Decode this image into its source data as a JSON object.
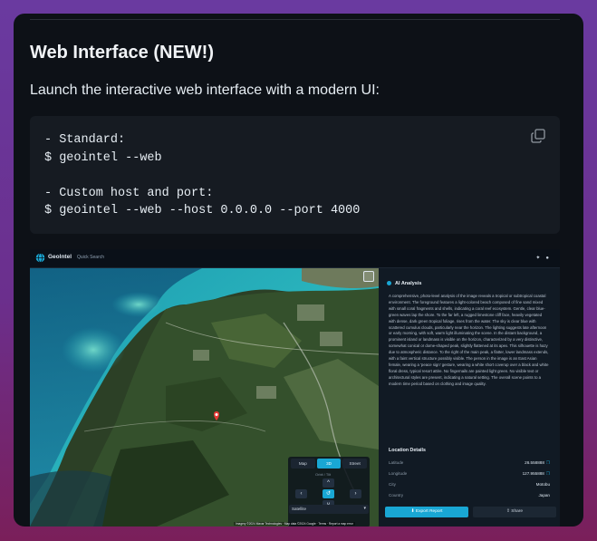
{
  "heading": "Web Interface (NEW!)",
  "lead": "Launch the interactive web interface with a modern UI:",
  "code": {
    "lines": [
      "- Standard:",
      "$ geointel --web",
      "",
      "- Custom host and port:",
      "$ geointel --web --host 0.0.0.0 --port 4000"
    ],
    "copy_icon": "copy-icon"
  },
  "app": {
    "brand": "GeoIntel",
    "nav_item": "Quick Search",
    "map": {
      "tabs": [
        "Map",
        "3D",
        "Street"
      ],
      "active_tab": "3D",
      "control_heading": "Orbit / Tilt",
      "layer_select": "Satellite",
      "attribution": "Imagery ©2024 Maxar Technologies · Map data ©2024 Google · Terms · Report a map error"
    },
    "analysis": {
      "title": "AI Analysis",
      "text": "A comprehensive, photo-level analysis of the image reveals a tropical or subtropical coastal environment. The foreground features a light-colored beach composed of fine sand mixed with small coral fragments and shells, indicating a coral reef ecosystem. Gentle, clear blue-green waves lap the shore. To the far left, a rugged limestone cliff face, heavily vegetated with dense, dark green tropical foliage, rises from the water. The sky is clear blue with scattered cumulus clouds, particularly near the horizon. The lighting suggests late afternoon or early morning, with soft, warm light illuminating the scene. In the distant background, a prominent island or landmass is visible on the horizon, characterized by a very distinctive, somewhat conical or dome-shaped peak, slightly flattened at its apex. This silhouette is hazy due to atmospheric distance. To the right of the main peak, a flatter, lower landmass extends, with a faint vertical structure possibly visible. The person in the image is an East Asian female, wearing a 'peace sign' gesture, wearing a white short coverup over a black and white floral dress, typical resort attire. No fingernails are painted light green. No visible text or architectural styles are present, indicating a natural setting. The overall scene points to a modern time period based on clothing and image quality."
    },
    "location": {
      "title": "Location Details",
      "rows": [
        {
          "label": "Latitude",
          "value": "26.558888"
        },
        {
          "label": "Longitude",
          "value": "127.955888"
        },
        {
          "label": "City",
          "value": "Motobu"
        },
        {
          "label": "Country",
          "value": "Japan"
        }
      ]
    },
    "buttons": {
      "export": "Export Report",
      "share": "Share"
    }
  },
  "colors": {
    "accent": "#19a7d4",
    "card_bg": "#0d1117",
    "code_bg": "#161b22"
  }
}
